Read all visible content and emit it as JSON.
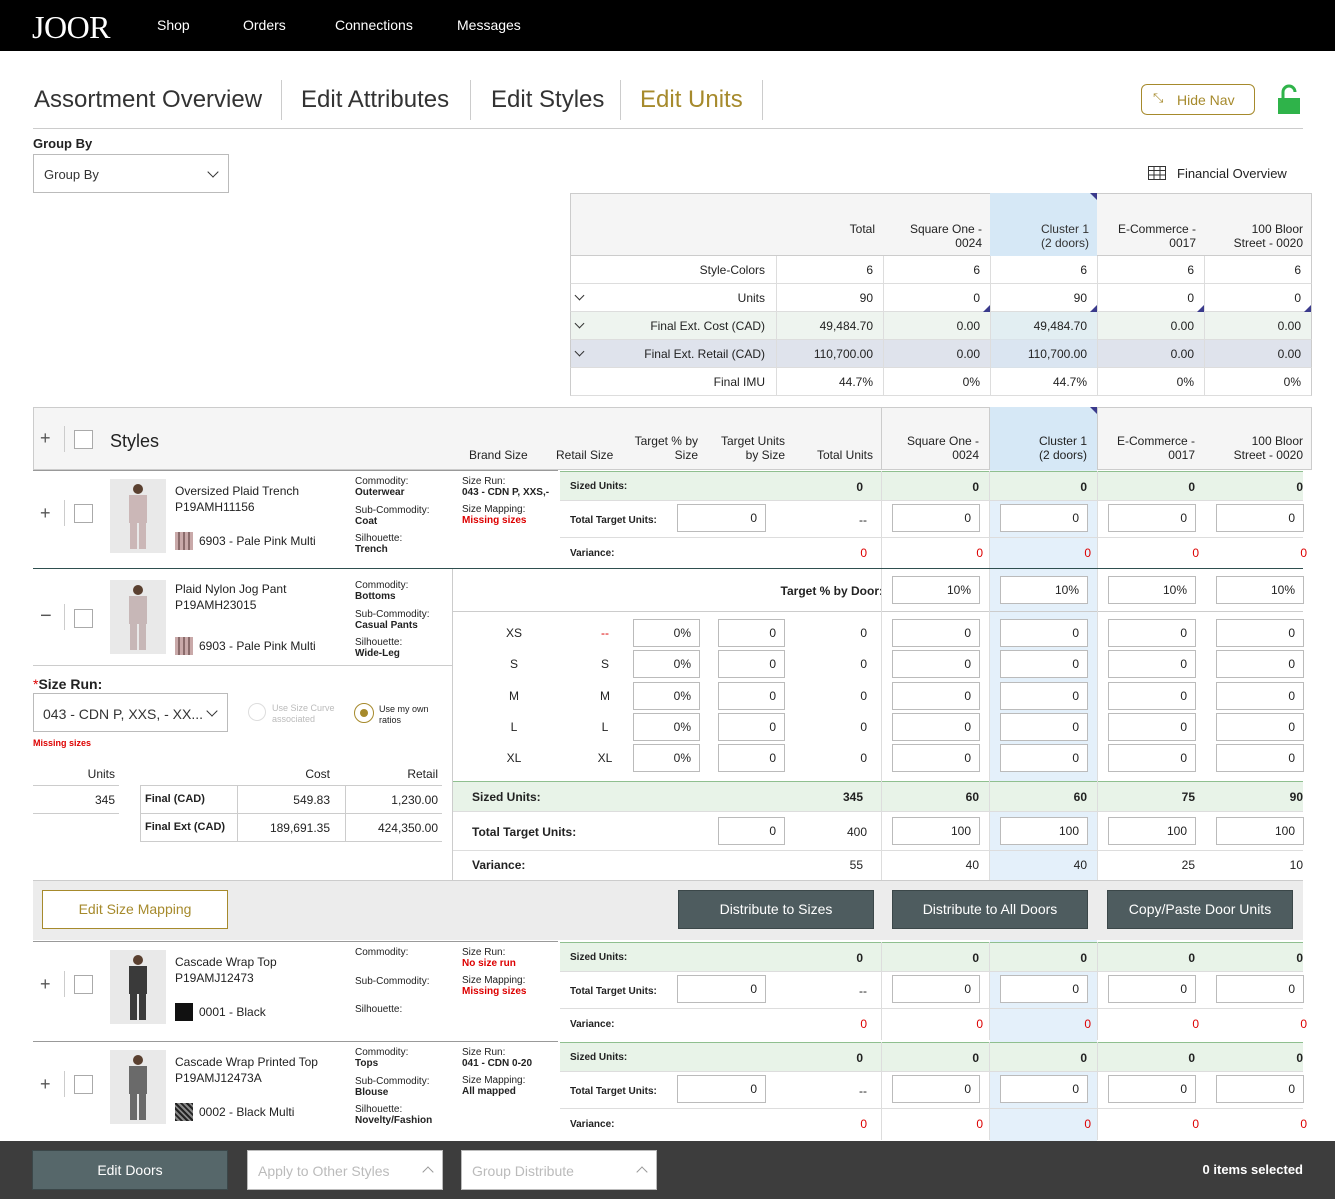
{
  "nav": {
    "logo": "JOOR",
    "links": [
      "Shop",
      "Orders",
      "Connections",
      "Messages"
    ]
  },
  "tabs": [
    "Assortment Overview",
    "Edit Attributes",
    "Edit Styles",
    "Edit Units"
  ],
  "hide_nav": "Hide Nav",
  "group_by": {
    "label": "Group By",
    "value": "Group By"
  },
  "financial_overview": "Financial Overview",
  "summary": {
    "columns": [
      "Total",
      "Square One -\n0024",
      "Cluster 1\n(2 doors)",
      "E-Commerce -\n0017",
      "100 Bloor\nStreet - 0020"
    ],
    "rows": [
      {
        "label": "Style-Colors",
        "values": [
          "6",
          "6",
          "6",
          "6",
          "6"
        ]
      },
      {
        "label": "Units",
        "values": [
          "90",
          "0",
          "90",
          "0",
          "0"
        ]
      },
      {
        "label": "Final Ext. Cost (CAD)",
        "values": [
          "49,484.70",
          "0.00",
          "49,484.70",
          "0.00",
          "0.00"
        ]
      },
      {
        "label": "Final Ext. Retail (CAD)",
        "values": [
          "110,700.00",
          "0.00",
          "110,700.00",
          "0.00",
          "0.00"
        ]
      },
      {
        "label": "Final IMU",
        "values": [
          "44.7%",
          "0%",
          "44.7%",
          "0%",
          "0%"
        ]
      }
    ]
  },
  "grid_header": {
    "styles": "Styles",
    "brand_size": "Brand Size",
    "retail_size": "Retail Size",
    "target_pct": "Target % by\nSize",
    "target_units": "Target Units\nby Size",
    "total_units": "Total Units",
    "doors": [
      "Square One -\n0024",
      "Cluster 1\n(2 doors)",
      "E-Commerce -\n0017",
      "100 Bloor\nStreet - 0020"
    ]
  },
  "labels": {
    "sized_units": "Sized Units:",
    "total_target_units": "Total Target Units:",
    "variance": "Variance:",
    "commodity": "Commodity:",
    "sub_commodity": "Sub-Commodity:",
    "silhouette": "Silhouette:",
    "size_run": "Size Run:",
    "size_mapping": "Size Mapping:",
    "target_by_door": "Target % by Door:",
    "size_run_req": "Size Run:",
    "use_size_curve": "Use Size Curve associated",
    "use_own": "Use my own ratios",
    "missing_sizes": "Missing sizes",
    "units": "Units",
    "cost": "Cost",
    "retail": "Retail",
    "final": "Final (CAD)",
    "final_ext": "Final Ext (CAD)"
  },
  "styles": [
    {
      "name": "Oversized Plaid Trench",
      "code": "P19AMH11156",
      "color": "6903 - Pale Pink Multi",
      "commodity": "Outerwear",
      "sub_commodity": "Coat",
      "silhouette": "Trench",
      "size_run": "043 - CDN P, XXS,-",
      "size_mapping": "Missing sizes",
      "sized": [
        "0",
        "0",
        "0",
        "0",
        "0"
      ],
      "target_input": "0",
      "target_total": "--",
      "door_targets": [
        "0",
        "0",
        "0",
        "0"
      ],
      "variance": [
        "0",
        "0",
        "0",
        "0",
        "0"
      ]
    },
    {
      "name": "Plaid Nylon Jog Pant",
      "code": "P19AMH23015",
      "color": "6903 - Pale Pink Multi",
      "commodity": "Bottoms",
      "sub_commodity": "Casual Pants",
      "silhouette": "Wide-Leg"
    },
    {
      "name": "Cascade Wrap Top",
      "code": "P19AMJ12473",
      "color": "0001 - Black",
      "commodity": "",
      "sub_commodity": "",
      "silhouette": "",
      "size_run": "No size run",
      "size_mapping": "Missing sizes",
      "sized": [
        "0",
        "0",
        "0",
        "0",
        "0"
      ],
      "target_input": "0",
      "target_total": "--",
      "door_targets": [
        "0",
        "0",
        "0",
        "0"
      ],
      "variance": [
        "0",
        "0",
        "0",
        "0",
        "0"
      ]
    },
    {
      "name": "Cascade Wrap Printed Top",
      "code": "P19AMJ12473A",
      "color": "0002 - Black Multi",
      "commodity": "Tops",
      "sub_commodity": "Blouse",
      "silhouette": "Novelty/Fashion",
      "size_run": "041 - CDN 0-20",
      "size_mapping": "All mapped",
      "sized": [
        "0",
        "0",
        "0",
        "0",
        "0"
      ],
      "target_input": "0",
      "target_total": "--",
      "door_targets": [
        "0",
        "0",
        "0",
        "0"
      ],
      "variance": [
        "0",
        "0",
        "0",
        "0",
        "0"
      ]
    }
  ],
  "expanded": {
    "size_run_value": "043 - CDN P, XXS, - XX...",
    "door_pct": [
      "10%",
      "10%",
      "10%",
      "10%"
    ],
    "sizes": [
      {
        "brand": "XS",
        "retail": "--",
        "pct": "0%",
        "units": "0",
        "total": "0",
        "doors": [
          "0",
          "0",
          "0",
          "0"
        ]
      },
      {
        "brand": "S",
        "retail": "S",
        "pct": "0%",
        "units": "0",
        "total": "0",
        "doors": [
          "0",
          "0",
          "0",
          "0"
        ]
      },
      {
        "brand": "M",
        "retail": "M",
        "pct": "0%",
        "units": "0",
        "total": "0",
        "doors": [
          "0",
          "0",
          "0",
          "0"
        ]
      },
      {
        "brand": "L",
        "retail": "L",
        "pct": "0%",
        "units": "0",
        "total": "0",
        "doors": [
          "0",
          "0",
          "0",
          "0"
        ]
      },
      {
        "brand": "XL",
        "retail": "XL",
        "pct": "0%",
        "units": "0",
        "total": "0",
        "doors": [
          "0",
          "0",
          "0",
          "0"
        ]
      }
    ],
    "units_value": "345",
    "final_cost": "549.83",
    "final_retail": "1,230.00",
    "final_ext_cost": "189,691.35",
    "final_ext_retail": "424,350.00",
    "sized_units": [
      "345",
      "60",
      "60",
      "75",
      "90"
    ],
    "target_input": "0",
    "target_total": "400",
    "door_targets": [
      "100",
      "100",
      "100",
      "100"
    ],
    "variance": [
      "55",
      "40",
      "40",
      "25",
      "10"
    ]
  },
  "actions": {
    "edit_size_mapping": "Edit Size Mapping",
    "distribute_sizes": "Distribute to Sizes",
    "distribute_doors": "Distribute to All Doors",
    "copy_paste": "Copy/Paste Door Units"
  },
  "bottom": {
    "edit_doors": "Edit Doors",
    "apply_other": "Apply to Other Styles",
    "group_distribute": "Group Distribute",
    "selected": "0 items selected"
  },
  "colors": {
    "accent": "#a68a2c",
    "lock": "#2fb34a",
    "dark_button": "#4e5c5f",
    "green_row": "#e8f3e8",
    "blue_col": "#d6e8f6"
  }
}
